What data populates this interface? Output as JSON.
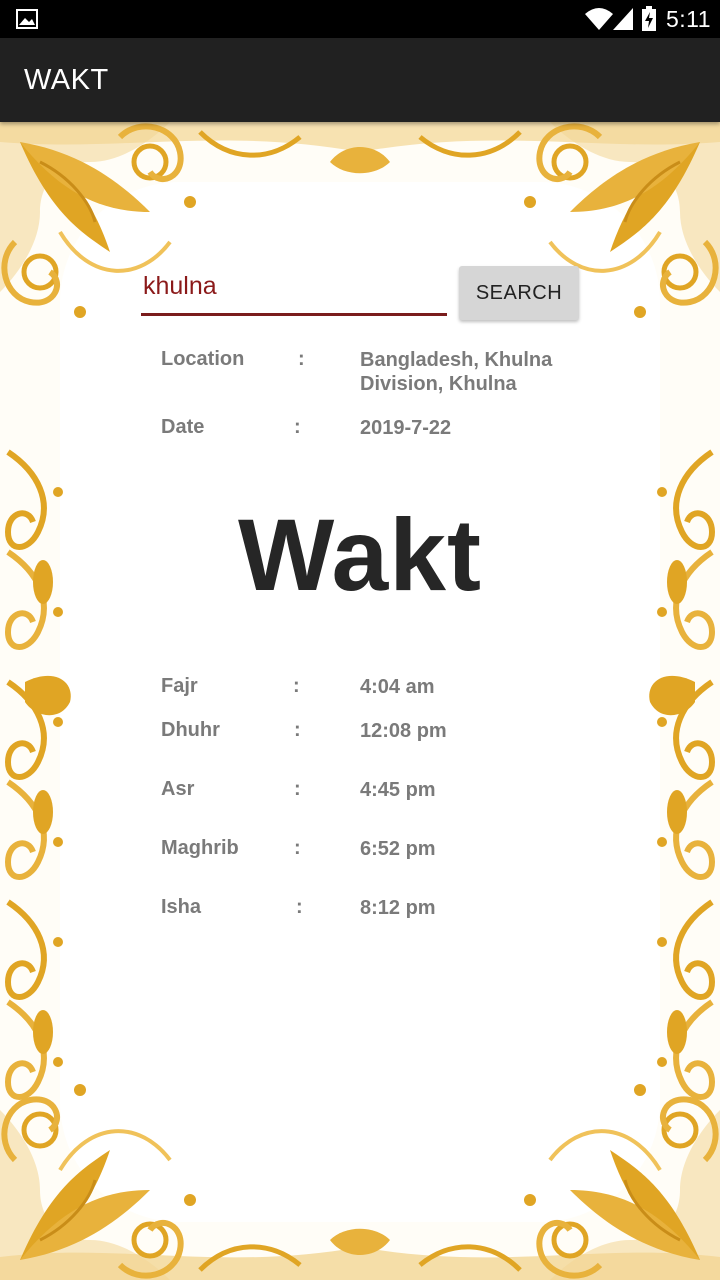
{
  "status_bar": {
    "time": "5:11",
    "icons": [
      "image-icon",
      "wifi-icon",
      "signal-icon",
      "battery-charging-icon"
    ]
  },
  "app_bar": {
    "title": "WAKT"
  },
  "search": {
    "value": "khulna",
    "button_label": "SEARCH"
  },
  "info": {
    "location_label": "Location",
    "location_value_line1": "Bangladesh, Khulna",
    "location_value_line2": "Division, Khulna",
    "date_label": "Date",
    "date_value": "2019-7-22",
    "separator": ":"
  },
  "heading": "Wakt",
  "prayers": [
    {
      "name": "Fajr",
      "time": "4:04 am"
    },
    {
      "name": "Dhuhr",
      "time": "12:08 pm"
    },
    {
      "name": "Asr",
      "time": "4:45 pm"
    },
    {
      "name": "Maghrib",
      "time": "6:52 pm"
    },
    {
      "name": "Isha",
      "time": "8:12 pm"
    }
  ],
  "colors": {
    "status_bar": "#000000",
    "app_bar": "#212121",
    "input_underline": "#7a1c1c",
    "input_text": "#8b1a1a",
    "label_text": "#7a7a7a",
    "frame_gold": "#e0a524",
    "frame_light": "#f3d693"
  }
}
